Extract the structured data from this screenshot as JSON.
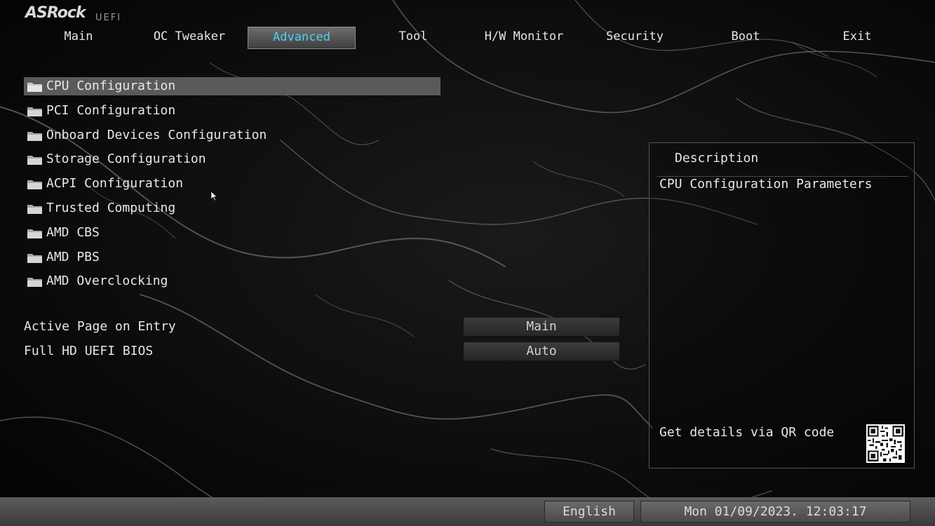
{
  "logo": {
    "brand": "ASRock",
    "sub": "UEFI"
  },
  "nav": {
    "tabs": [
      "Main",
      "OC Tweaker",
      "Advanced",
      "Tool",
      "H/W Monitor",
      "Security",
      "Boot",
      "Exit"
    ],
    "active": "Advanced"
  },
  "menu": {
    "items": [
      {
        "label": "CPU Configuration",
        "icon": "folder-icon",
        "selected": true
      },
      {
        "label": "PCI Configuration",
        "icon": "folder-icon"
      },
      {
        "label": "Onboard Devices Configuration",
        "icon": "folder-icon"
      },
      {
        "label": "Storage Configuration",
        "icon": "folder-icon"
      },
      {
        "label": "ACPI Configuration",
        "icon": "folder-icon"
      },
      {
        "label": "Trusted Computing",
        "icon": "folder-icon"
      },
      {
        "label": "AMD CBS",
        "icon": "folder-icon"
      },
      {
        "label": "AMD PBS",
        "icon": "folder-icon"
      },
      {
        "label": "AMD Overclocking",
        "icon": "folder-icon"
      }
    ]
  },
  "settings": [
    {
      "label": "Active Page on Entry",
      "value": "Main"
    },
    {
      "label": "Full HD UEFI BIOS",
      "value": "Auto"
    }
  ],
  "description": {
    "title": "Description",
    "text": "CPU Configuration Parameters",
    "qr_label": "Get details via QR code"
  },
  "footer": {
    "language": "English",
    "datetime": "Mon 01/09/2023. 12:03:17"
  },
  "colors": {
    "active_tab_text": "#4fd2f5",
    "selected_row": "#5a5a5a",
    "background": "#060606"
  }
}
